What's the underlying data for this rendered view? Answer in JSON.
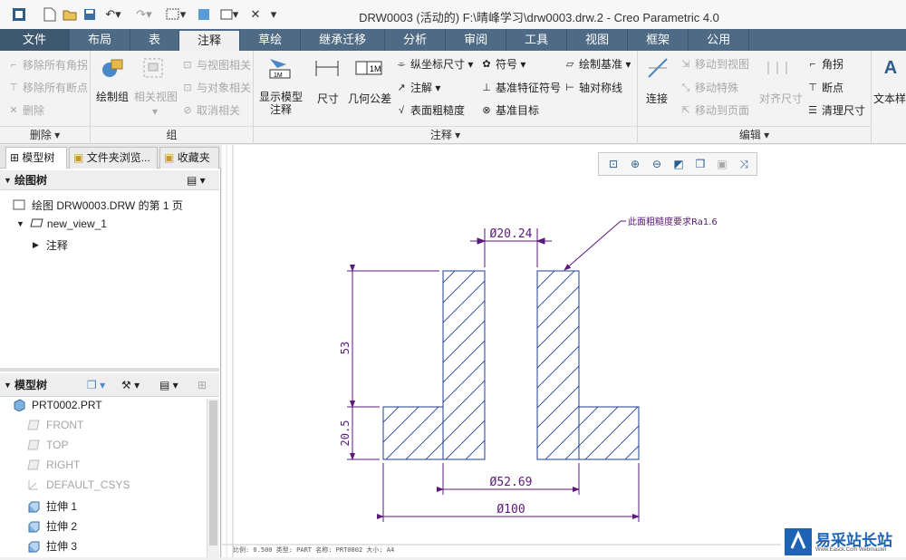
{
  "window": {
    "title": "DRW0003 (活动的) F:\\晴峰学习\\drw0003.drw.2 - Creo Parametric 4.0"
  },
  "tabs": [
    "文件",
    "布局",
    "表",
    "注释",
    "草绘",
    "继承迁移",
    "分析",
    "审阅",
    "工具",
    "视图",
    "框架",
    "公用"
  ],
  "ribbon": {
    "delete_group": {
      "items": [
        "移除所有角拐",
        "移除所有断点",
        "删除"
      ],
      "name": "删除"
    },
    "group_group": {
      "draw_group": "绘制组",
      "related_view": "相关视图",
      "items": [
        "与视图相关",
        "与对象相关",
        "取消相关"
      ],
      "name": "组"
    },
    "annotate_group": {
      "show_model": "显示模型\n注释",
      "dimension": "尺寸",
      "gtol": "几何公差",
      "ordinate": "纵坐标尺寸",
      "note": "注解",
      "surface_finish": "表面粗糙度",
      "symbol": "符号",
      "datum_feature": "基准特征符号",
      "datum_target": "基准目标",
      "draw_datum": "绘制基准",
      "axis_sym": "轴对称线",
      "name": "注释"
    },
    "edit_group": {
      "connect": "连接",
      "move_to_view": "移动到视图",
      "move_special": "移动特殊",
      "move_to_page": "移动到页面",
      "align_dim": "对齐尺寸",
      "corner": "角拐",
      "breakpoint": "断点",
      "cleanup": "清理尺寸",
      "name": "编辑"
    },
    "text_style": "文本样"
  },
  "left_panel": {
    "tabs": [
      "模型树",
      "文件夹浏览...",
      "收藏夹"
    ],
    "drawing_tree_title": "绘图树",
    "drawing_tree": [
      "绘图 DRW0003.DRW 的第 1 页",
      "new_view_1",
      "注释"
    ],
    "model_tree_title": "模型树",
    "model_tree": [
      {
        "label": "PRT0002.PRT",
        "dim": false,
        "icon": "part-icon"
      },
      {
        "label": "FRONT",
        "dim": true,
        "icon": "plane-icon"
      },
      {
        "label": "TOP",
        "dim": true,
        "icon": "plane-icon"
      },
      {
        "label": "RIGHT",
        "dim": true,
        "icon": "plane-icon"
      },
      {
        "label": "DEFAULT_CSYS",
        "dim": true,
        "icon": "csys-icon"
      },
      {
        "label": "拉伸 1",
        "dim": false,
        "icon": "extrude-icon"
      },
      {
        "label": "拉伸 2",
        "dim": false,
        "icon": "extrude-icon"
      },
      {
        "label": "拉伸 3",
        "dim": false,
        "icon": "extrude-icon"
      }
    ]
  },
  "drawing": {
    "dims": {
      "top_bore": "Ø20.24",
      "mid": "Ø52.69",
      "bottom": "Ø100",
      "height": "53",
      "flange": "20.5"
    },
    "note": "此面粗糙度要求Ra1.6",
    "status": "比例: 0.500   类型: PART   名称: PRT0002   大小: A4",
    "line_color": "#1f3f8f",
    "dim_color": "#5a1a7a"
  },
  "watermark": {
    "title": "易采站长站",
    "sub": "Www.Easck.Com Webmaster"
  }
}
